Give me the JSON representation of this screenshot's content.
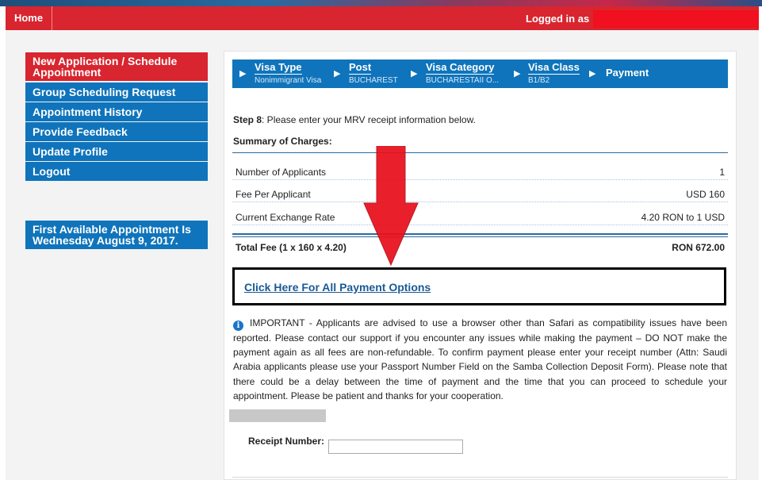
{
  "header": {
    "home_label": "Home",
    "logged_in_label": "Logged in as"
  },
  "sidebar": {
    "items": [
      {
        "label": "New Application / Schedule Appointment"
      },
      {
        "label": "Group Scheduling Request"
      },
      {
        "label": "Appointment History"
      },
      {
        "label": "Provide Feedback"
      },
      {
        "label": "Update Profile"
      },
      {
        "label": "Logout"
      }
    ],
    "notice": "First Available Appointment Is Wednesday August 9, 2017."
  },
  "steps": [
    {
      "title": "Visa Type",
      "value": "Nonimmigrant Visa"
    },
    {
      "title": "Post",
      "value": "BUCHAREST"
    },
    {
      "title": "Visa Category",
      "value": "BUCHARESTAII O..."
    },
    {
      "title": "Visa Class",
      "value": "B1/B2"
    },
    {
      "title": "Payment",
      "value": ""
    }
  ],
  "main": {
    "step_label": "Step 8",
    "step_text": ": Please enter your MRV receipt information below.",
    "summary_title": "Summary of Charges:",
    "charges": [
      {
        "label": "Number of Applicants",
        "value": "1"
      },
      {
        "label": "Fee Per Applicant",
        "value": "USD 160"
      },
      {
        "label": "Current Exchange Rate",
        "value": "4.20 RON to 1 USD"
      }
    ],
    "total_label": "Total Fee (1 x 160 x 4.20)",
    "total_value": "RON 672.00",
    "payment_link": "Click Here For All Payment Options",
    "important_text": "IMPORTANT - Applicants are advised to use a browser other than Safari as compatibility issues have been reported. Please contact our support if you encounter any issues while making the payment – DO NOT make the payment again as all fees are non-refundable. To confirm payment please enter your receipt number (Attn: Saudi Arabia applicants please use your Passport Number Field on the Samba Collection Deposit Form). Please note that there could be a delay between the time of payment and the time that you can proceed to schedule your appointment. Please be patient and thanks for your cooperation.",
    "receipt_label": "Receipt Number:",
    "receipt_value": ""
  },
  "colors": {
    "brand_red": "#d8252f",
    "brand_blue": "#0f74bb",
    "link_blue": "#1a5a96",
    "arrow_red": "#e8101c"
  },
  "icons": [
    "info-icon",
    "step-arrow-icon",
    "annotation-arrow-icon"
  ]
}
